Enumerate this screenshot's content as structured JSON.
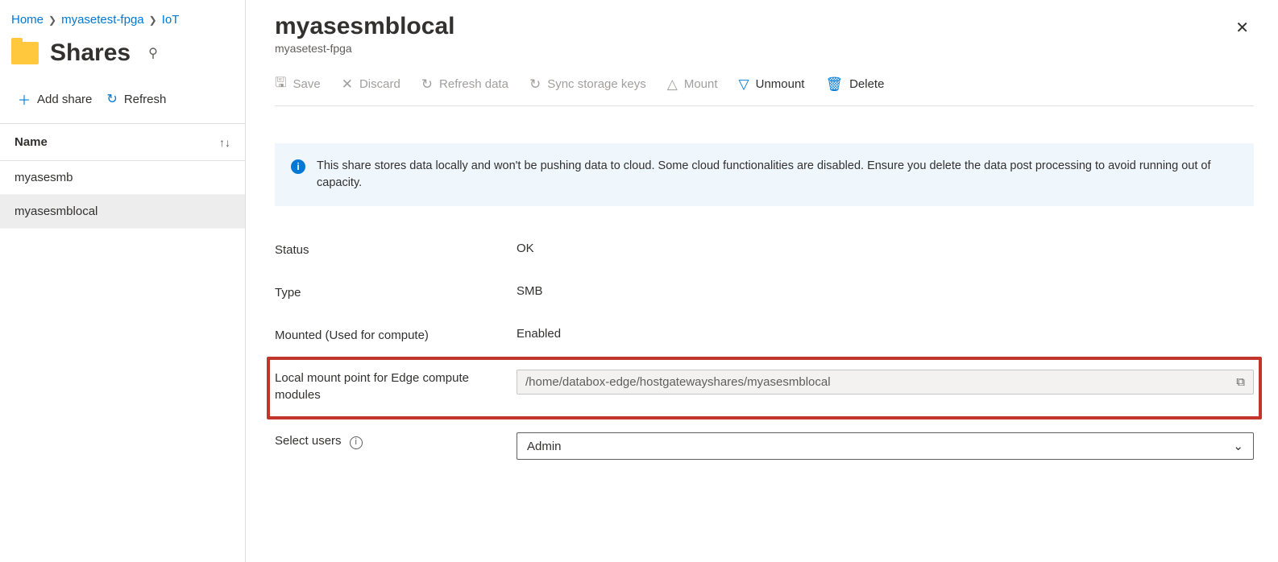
{
  "breadcrumb": {
    "home": "Home",
    "resource": "myasetest-fpga",
    "tail": "IoT"
  },
  "left": {
    "title": "Shares",
    "add_label": "Add share",
    "refresh_label": "Refresh",
    "col_name": "Name",
    "rows": [
      "myasesmb",
      "myasesmblocal"
    ]
  },
  "detail": {
    "title": "myasesmblocal",
    "subtitle": "myasetest-fpga",
    "cmd": {
      "save": "Save",
      "discard": "Discard",
      "refresh_data": "Refresh data",
      "sync": "Sync storage keys",
      "mount": "Mount",
      "unmount": "Unmount",
      "delete": "Delete"
    },
    "info_msg": "This share stores data locally and won't be pushing data to cloud. Some cloud functionalities are disabled. Ensure you delete the data post processing to avoid running out of capacity.",
    "props": {
      "status_label": "Status",
      "status_value": "OK",
      "type_label": "Type",
      "type_value": "SMB",
      "mounted_label": "Mounted (Used for compute)",
      "mounted_value": "Enabled",
      "mountpoint_label": "Local mount point for Edge compute modules",
      "mountpoint_value": "/home/databox-edge/hostgatewayshares/myasesmblocal",
      "select_users_label": "Select users",
      "select_users_value": "Admin"
    }
  }
}
